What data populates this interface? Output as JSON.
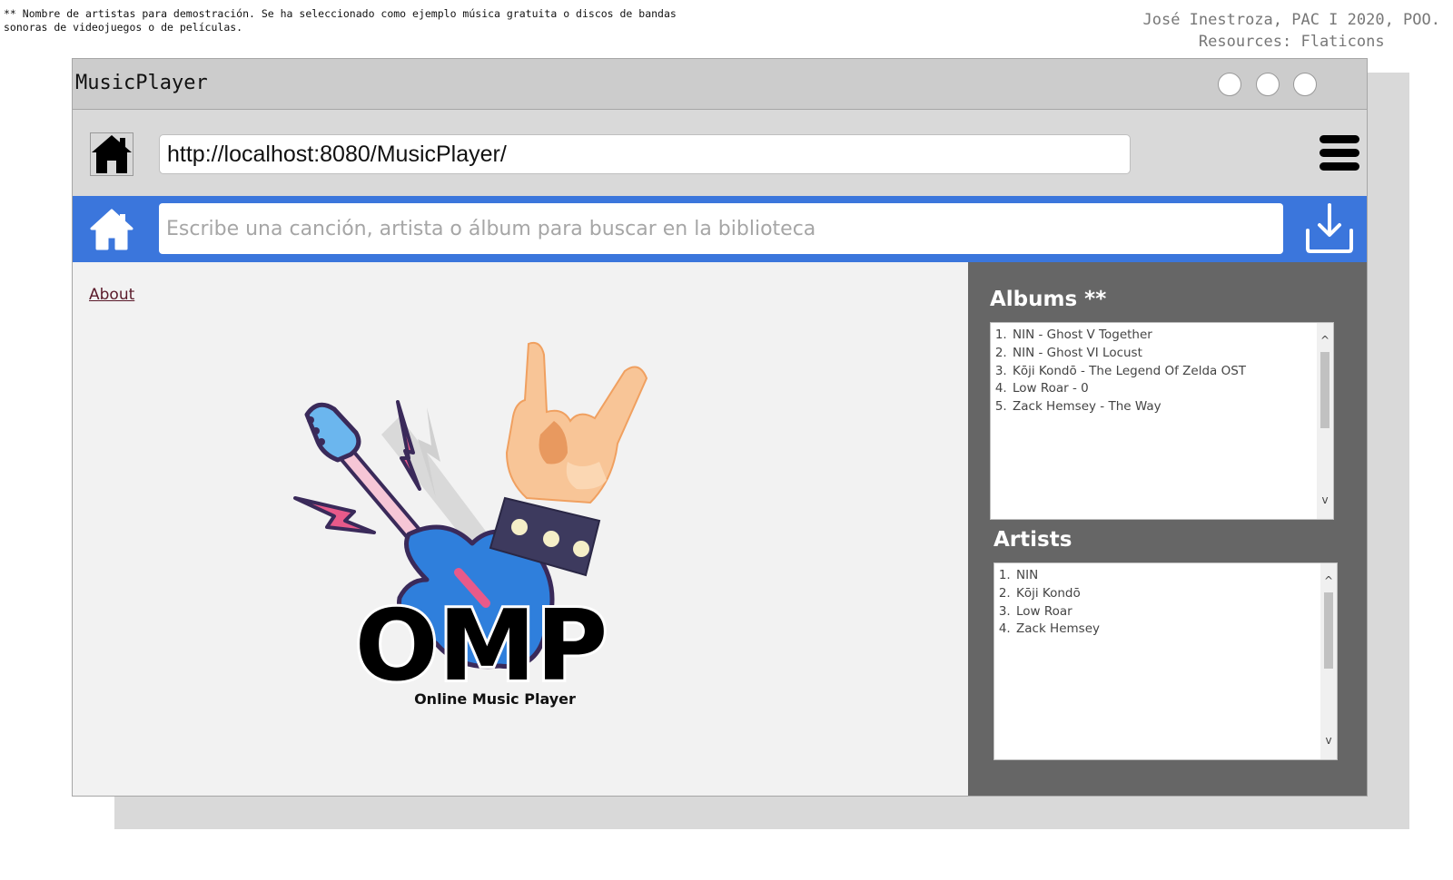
{
  "annotations": {
    "footnote": "** Nombre de artistas para demostración. Se ha seleccionado como ejemplo música gratuita o discos de bandas sonoras de videojuegos o de películas.",
    "credits_line1": "José Inestroza, PAC I 2020, POO.",
    "credits_line2": "Resources: Flaticons"
  },
  "window": {
    "title": "MusicPlayer"
  },
  "navbar": {
    "url": "http://localhost:8080/MusicPlayer/"
  },
  "searchbar": {
    "placeholder": "Escribe una canción, artista o álbum para buscar en la biblioteca"
  },
  "main": {
    "about_label": "About",
    "logo_text": "OMP",
    "logo_subtitle": "Online Music Player"
  },
  "albums": {
    "title": "Albums **",
    "items": [
      "NIN - Ghost V Together",
      "NIN - Ghost VI Locust",
      "Kōji Kondō - The Legend Of Zelda OST",
      "Low Roar - 0",
      "Zack Hemsey - The Way"
    ]
  },
  "artists": {
    "title": "Artists",
    "items": [
      "NIN",
      "Kōji Kondō",
      "Low Roar",
      "Zack Hemsey"
    ]
  },
  "icons": {
    "scroll_up": "^",
    "scroll_down": "v"
  },
  "colors": {
    "accent_blue": "#3b76dc",
    "sidebar_gray": "#666666"
  }
}
